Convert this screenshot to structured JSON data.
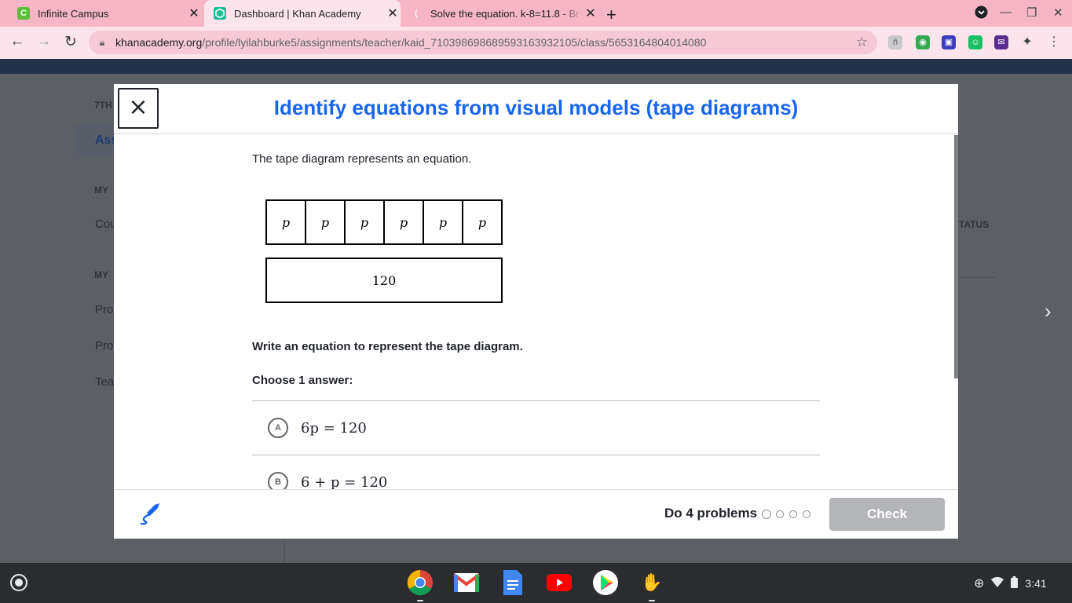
{
  "browser": {
    "tabs": [
      {
        "title": "Infinite Campus",
        "favicon": "C",
        "active": false
      },
      {
        "title": "Dashboard | Khan Academy",
        "favicon": "khan-academy-icon",
        "active": true
      },
      {
        "title": "Solve the equation. k-8=11.8 - Br",
        "favicon": "brainly-icon",
        "active": false
      }
    ],
    "new_tab": "+",
    "url_host": "khanacademy.org",
    "url_path": "/profile/lyilahburke5/assignments/teacher/kaid_710398698689593163932105/class/5653164804014080"
  },
  "background_page": {
    "section_top": "7TH",
    "selected_item": "Ass",
    "header_my_1": "MY",
    "item_cou": "Cou",
    "header_my_2": "MY",
    "item_pro_1": "Pro",
    "item_pro_2": "Pro",
    "item_tea": "Tea",
    "status_header": "TATUS"
  },
  "modal": {
    "title": "Identify equations from visual models (tape diagrams)",
    "prompt": "The tape diagram represents an equation.",
    "tape_cells": [
      "p",
      "p",
      "p",
      "p",
      "p",
      "p"
    ],
    "tape_total": "120",
    "question": "Write an equation to represent the tape diagram.",
    "choose_label": "Choose 1 answer:",
    "options": [
      {
        "letter": "A",
        "equation": "6p = 120"
      },
      {
        "letter": "B",
        "equation": "6 + p = 120"
      }
    ],
    "footer": {
      "do_problems": "Do 4 problems",
      "progress_total": 4,
      "progress_done": 0,
      "check_label": "Check"
    }
  },
  "shelf": {
    "time": "3:41"
  },
  "colors": {
    "ka_blue": "#1865f2",
    "tab_strip": "#f6b6c6",
    "toolbar": "#fce4ec",
    "check_disabled": "#b4b5b8"
  }
}
